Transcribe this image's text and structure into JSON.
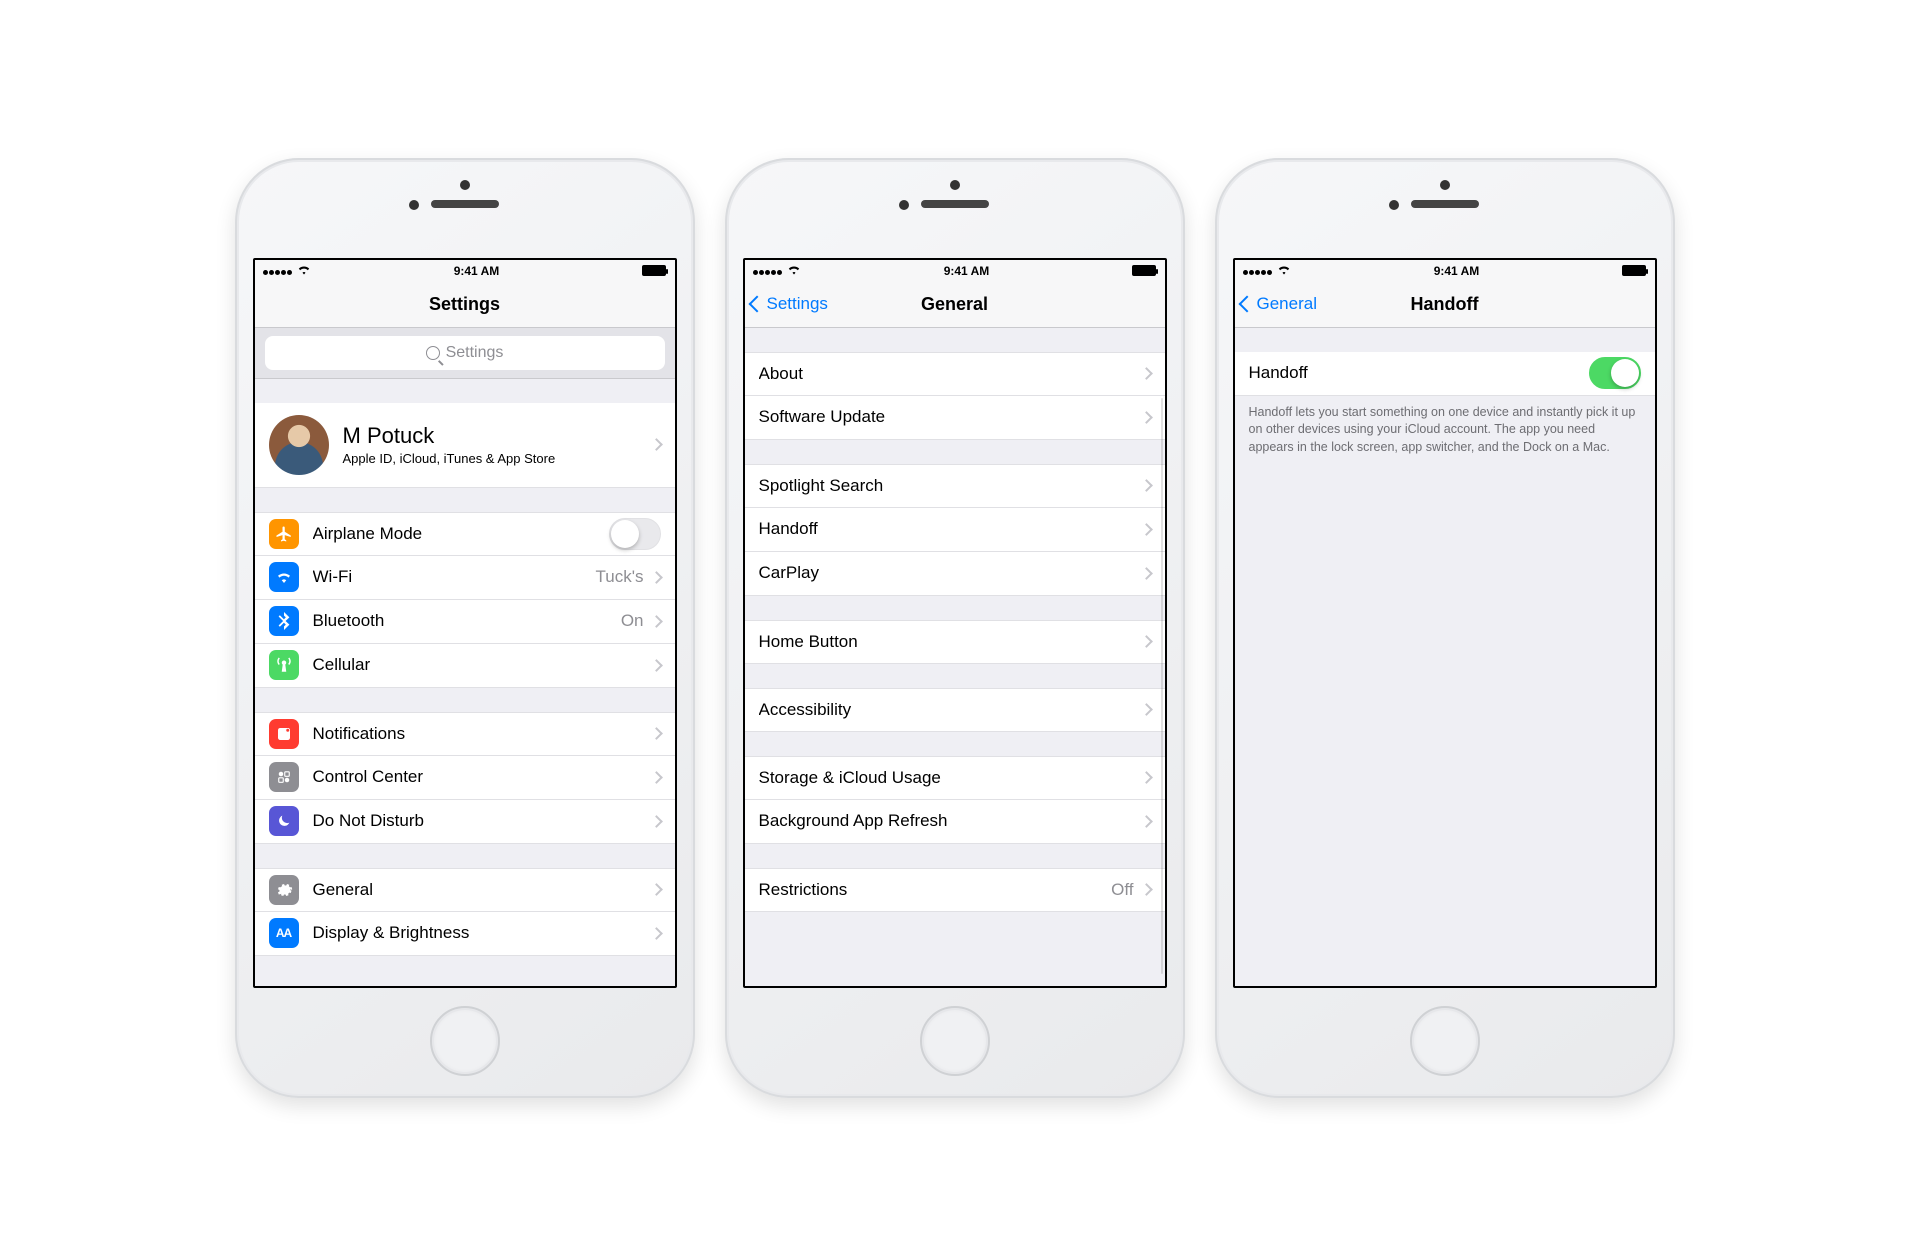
{
  "status": {
    "time": "9:41 AM"
  },
  "colors": {
    "tint": "#007aff",
    "switch_on": "#4cd964"
  },
  "screen1": {
    "title": "Settings",
    "search_placeholder": "Settings",
    "profile": {
      "name": "M Potuck",
      "subtitle": "Apple ID, iCloud, iTunes & App Store"
    },
    "groups": [
      [
        {
          "icon": "plane",
          "icon_bg": "#ff9500",
          "label": "Airplane Mode",
          "type": "switch",
          "on": false
        },
        {
          "icon": "wifi",
          "icon_bg": "#007aff",
          "label": "Wi-Fi",
          "value": "Tuck's"
        },
        {
          "icon": "bt",
          "icon_bg": "#007aff",
          "label": "Bluetooth",
          "value": "On"
        },
        {
          "icon": "cell",
          "icon_bg": "#4cd964",
          "label": "Cellular"
        }
      ],
      [
        {
          "icon": "bell",
          "icon_bg": "#ff3b30",
          "label": "Notifications"
        },
        {
          "icon": "cc",
          "icon_bg": "#8e8e93",
          "label": "Control Center"
        },
        {
          "icon": "moon",
          "icon_bg": "#5856d6",
          "label": "Do Not Disturb"
        }
      ],
      [
        {
          "icon": "gear",
          "icon_bg": "#8e8e93",
          "label": "General"
        },
        {
          "icon": "aa",
          "icon_bg": "#007aff",
          "label": "Display & Brightness"
        }
      ]
    ]
  },
  "screen2": {
    "back": "Settings",
    "title": "General",
    "groups": [
      [
        {
          "label": "About"
        },
        {
          "label": "Software Update"
        }
      ],
      [
        {
          "label": "Spotlight Search"
        },
        {
          "label": "Handoff"
        },
        {
          "label": "CarPlay"
        }
      ],
      [
        {
          "label": "Home Button"
        }
      ],
      [
        {
          "label": "Accessibility"
        }
      ],
      [
        {
          "label": "Storage & iCloud Usage"
        },
        {
          "label": "Background App Refresh"
        }
      ],
      [
        {
          "label": "Restrictions",
          "value": "Off"
        }
      ]
    ]
  },
  "screen3": {
    "back": "General",
    "title": "Handoff",
    "row": {
      "label": "Handoff",
      "on": true
    },
    "footer": "Handoff lets you start something on one device and instantly pick it up on other devices using your iCloud account. The app you need appears in the lock screen, app switcher, and the Dock on a Mac."
  }
}
